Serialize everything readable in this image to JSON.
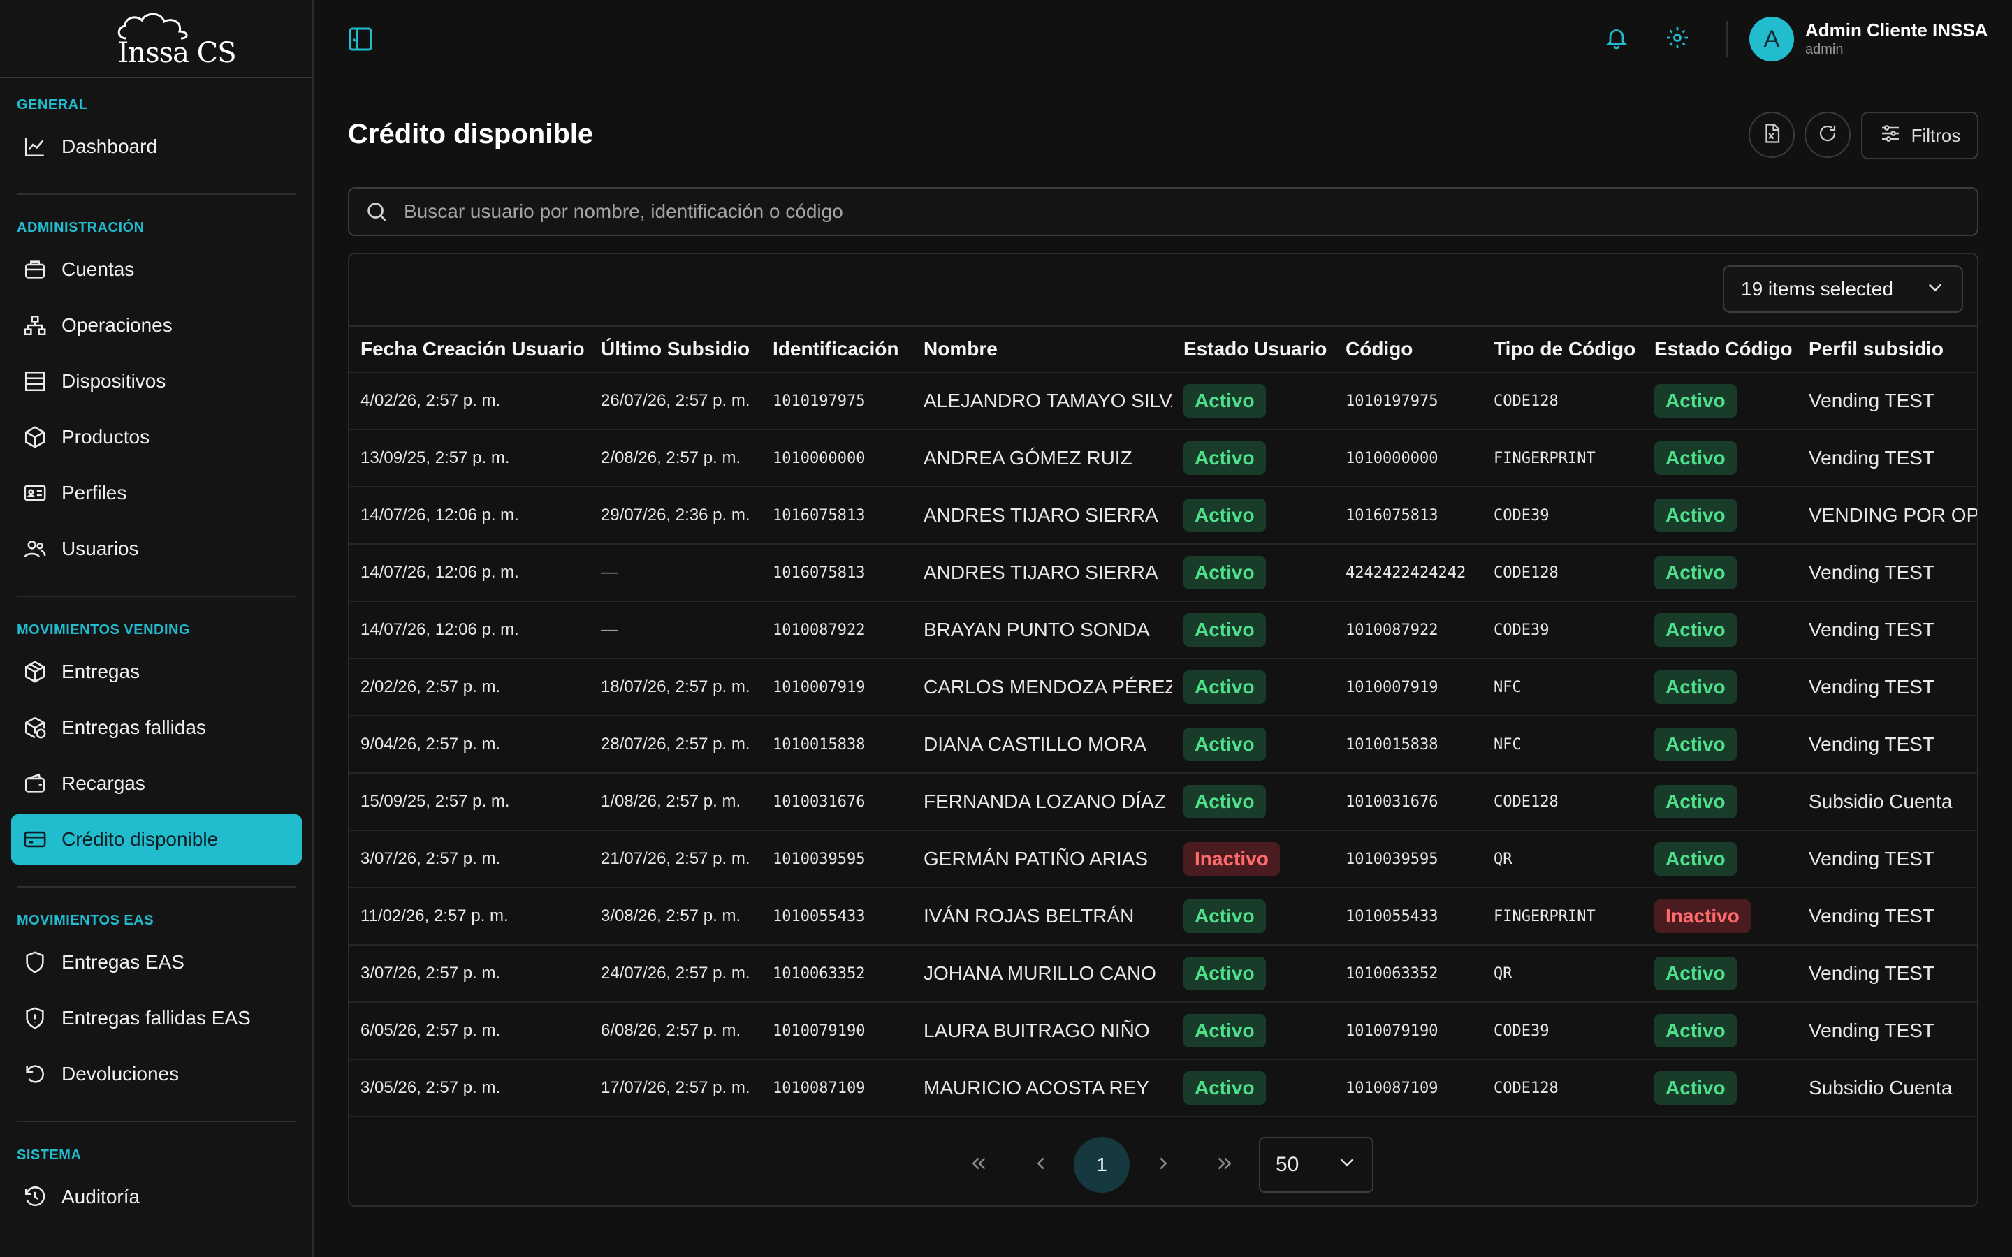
{
  "brand": {
    "logo_text": "Inssa CS"
  },
  "sidebar": {
    "sections": [
      {
        "label": "GENERAL"
      },
      {
        "label": "ADMINISTRACIÓN"
      },
      {
        "label": "MOVIMIENTOS VENDING"
      },
      {
        "label": "MOVIMIENTOS EAS"
      },
      {
        "label": "SISTEMA"
      }
    ],
    "items": [
      {
        "label": "Dashboard",
        "icon": "chart-line-icon"
      },
      {
        "label": "Cuentas",
        "icon": "briefcase-icon"
      },
      {
        "label": "Operaciones",
        "icon": "network-icon"
      },
      {
        "label": "Dispositivos",
        "icon": "server-icon"
      },
      {
        "label": "Productos",
        "icon": "box-icon"
      },
      {
        "label": "Perfiles",
        "icon": "id-card-icon"
      },
      {
        "label": "Usuarios",
        "icon": "users-icon"
      },
      {
        "label": "Entregas",
        "icon": "package-icon"
      },
      {
        "label": "Entregas fallidas",
        "icon": "package-alert-icon"
      },
      {
        "label": "Recargas",
        "icon": "wallet-icon"
      },
      {
        "label": "Crédito disponible",
        "icon": "credit-card-icon"
      },
      {
        "label": "Entregas EAS",
        "icon": "shield-icon"
      },
      {
        "label": "Entregas fallidas EAS",
        "icon": "shield-alert-icon"
      },
      {
        "label": "Devoluciones",
        "icon": "rotate-ccw-icon"
      },
      {
        "label": "Auditoría",
        "icon": "history-icon"
      }
    ]
  },
  "header": {
    "user_initial": "A",
    "user_name": "Admin Cliente INSSA",
    "user_role": "admin"
  },
  "page": {
    "title": "Crédito disponible",
    "filters_label": "Filtros",
    "search_placeholder": "Buscar usuario por nombre, identificación o código",
    "columns_selected": "19 items selected"
  },
  "table": {
    "columns": [
      "Fecha Creación Usuario",
      "Último Subsidio",
      "Identificación",
      "Nombre",
      "Estado Usuario",
      "Código",
      "Tipo de Código",
      "Estado Código",
      "Perfil subsidio"
    ],
    "rows": [
      [
        "4/02/26, 2:57 p. m.",
        "26/07/26, 2:57 p. m.",
        "1010197975",
        "ALEJANDRO TAMAYO SILVA",
        "Activo",
        "1010197975",
        "CODE128",
        "Activo",
        "Vending TEST"
      ],
      [
        "13/09/25, 2:57 p. m.",
        "2/08/26, 2:57 p. m.",
        "1010000000",
        "ANDREA GÓMEZ RUIZ",
        "Activo",
        "1010000000",
        "FINGERPRINT",
        "Activo",
        "Vending TEST"
      ],
      [
        "14/07/26, 12:06 p. m.",
        "29/07/26, 2:36 p. m.",
        "1016075813",
        "ANDRES TIJARO SIERRA",
        "Activo",
        "1016075813",
        "CODE39",
        "Activo",
        "VENDING POR OPERACION"
      ],
      [
        "14/07/26, 12:06 p. m.",
        "—",
        "1016075813",
        "ANDRES TIJARO SIERRA",
        "Activo",
        "4242422424242",
        "CODE128",
        "Activo",
        "Vending TEST"
      ],
      [
        "14/07/26, 12:06 p. m.",
        "—",
        "1010087922",
        "BRAYAN PUNTO SONDA",
        "Activo",
        "1010087922",
        "CODE39",
        "Activo",
        "Vending TEST"
      ],
      [
        "2/02/26, 2:57 p. m.",
        "18/07/26, 2:57 p. m.",
        "1010007919",
        "CARLOS MENDOZA PÉREZ",
        "Activo",
        "1010007919",
        "NFC",
        "Activo",
        "Vending TEST"
      ],
      [
        "9/04/26, 2:57 p. m.",
        "28/07/26, 2:57 p. m.",
        "1010015838",
        "DIANA CASTILLO MORA",
        "Activo",
        "1010015838",
        "NFC",
        "Activo",
        "Vending TEST"
      ],
      [
        "15/09/25, 2:57 p. m.",
        "1/08/26, 2:57 p. m.",
        "1010031676",
        "FERNANDA LOZANO DÍAZ",
        "Activo",
        "1010031676",
        "CODE128",
        "Activo",
        "Subsidio Cuenta"
      ],
      [
        "3/07/26, 2:57 p. m.",
        "21/07/26, 2:57 p. m.",
        "1010039595",
        "GERMÁN PATIÑO ARIAS",
        "Inactivo",
        "1010039595",
        "QR",
        "Activo",
        "Vending TEST"
      ],
      [
        "11/02/26, 2:57 p. m.",
        "3/08/26, 2:57 p. m.",
        "1010055433",
        "IVÁN ROJAS BELTRÁN",
        "Activo",
        "1010055433",
        "FINGERPRINT",
        "Inactivo",
        "Vending TEST"
      ],
      [
        "3/07/26, 2:57 p. m.",
        "24/07/26, 2:57 p. m.",
        "1010063352",
        "JOHANA MURILLO CANO",
        "Activo",
        "1010063352",
        "QR",
        "Activo",
        "Vending TEST"
      ],
      [
        "6/05/26, 2:57 p. m.",
        "6/08/26, 2:57 p. m.",
        "1010079190",
        "LAURA BUITRAGO NIÑO",
        "Activo",
        "1010079190",
        "CODE39",
        "Activo",
        "Vending TEST"
      ],
      [
        "3/05/26, 2:57 p. m.",
        "17/07/26, 2:57 p. m.",
        "1010087109",
        "MAURICIO ACOSTA REY",
        "Activo",
        "1010087109",
        "CODE128",
        "Activo",
        "Subsidio Cuenta"
      ]
    ]
  },
  "pagination": {
    "current_page": "1",
    "page_size": "50"
  },
  "colors": {
    "accent": "#22bccf",
    "active_green": "#4ee08a",
    "inactive_red": "#ff6b6b"
  }
}
